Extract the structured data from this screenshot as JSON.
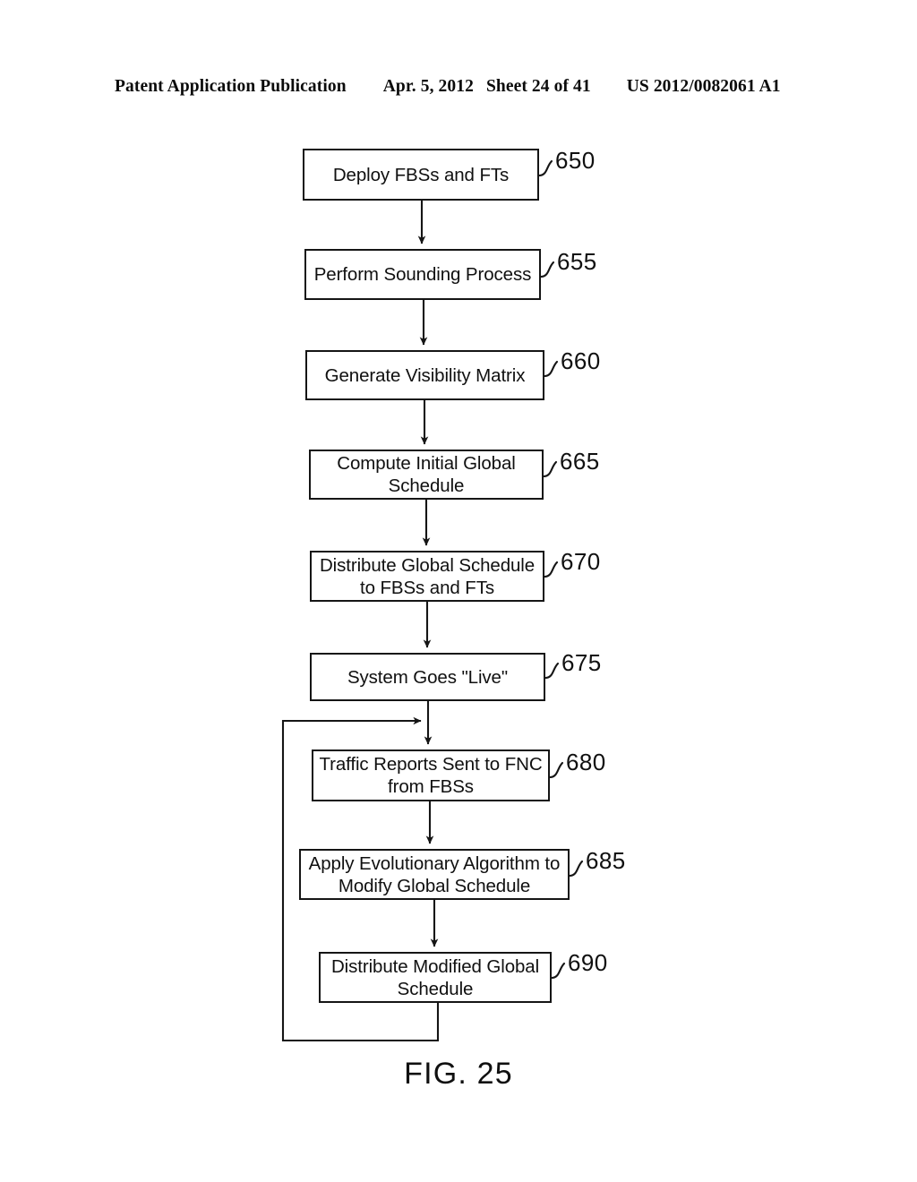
{
  "header": {
    "publication": "Patent Application Publication",
    "date": "Apr. 5, 2012",
    "sheet": "Sheet 24 of 41",
    "patent_number": "US 2012/0082061 A1"
  },
  "figure": {
    "caption": "FIG. 25",
    "nodes": [
      {
        "id": "650",
        "ref": "650",
        "text": "Deploy FBSs and FTs"
      },
      {
        "id": "655",
        "ref": "655",
        "text": "Perform Sounding Process"
      },
      {
        "id": "660",
        "ref": "660",
        "text": "Generate Visibility Matrix"
      },
      {
        "id": "665",
        "ref": "665",
        "text": "Compute Initial Global\nSchedule"
      },
      {
        "id": "670",
        "ref": "670",
        "text": "Distribute Global Schedule\nto FBSs and FTs"
      },
      {
        "id": "675",
        "ref": "675",
        "text": "System Goes \"Live\""
      },
      {
        "id": "680",
        "ref": "680",
        "text": "Traffic Reports Sent to FNC\nfrom FBSs"
      },
      {
        "id": "685",
        "ref": "685",
        "text": "Apply Evolutionary Algorithm to\nModify Global Schedule"
      },
      {
        "id": "690",
        "ref": "690",
        "text": "Distribute Modified Global\nSchedule"
      }
    ]
  },
  "colors": {
    "ink": "#101010",
    "paper": "#ffffff"
  }
}
